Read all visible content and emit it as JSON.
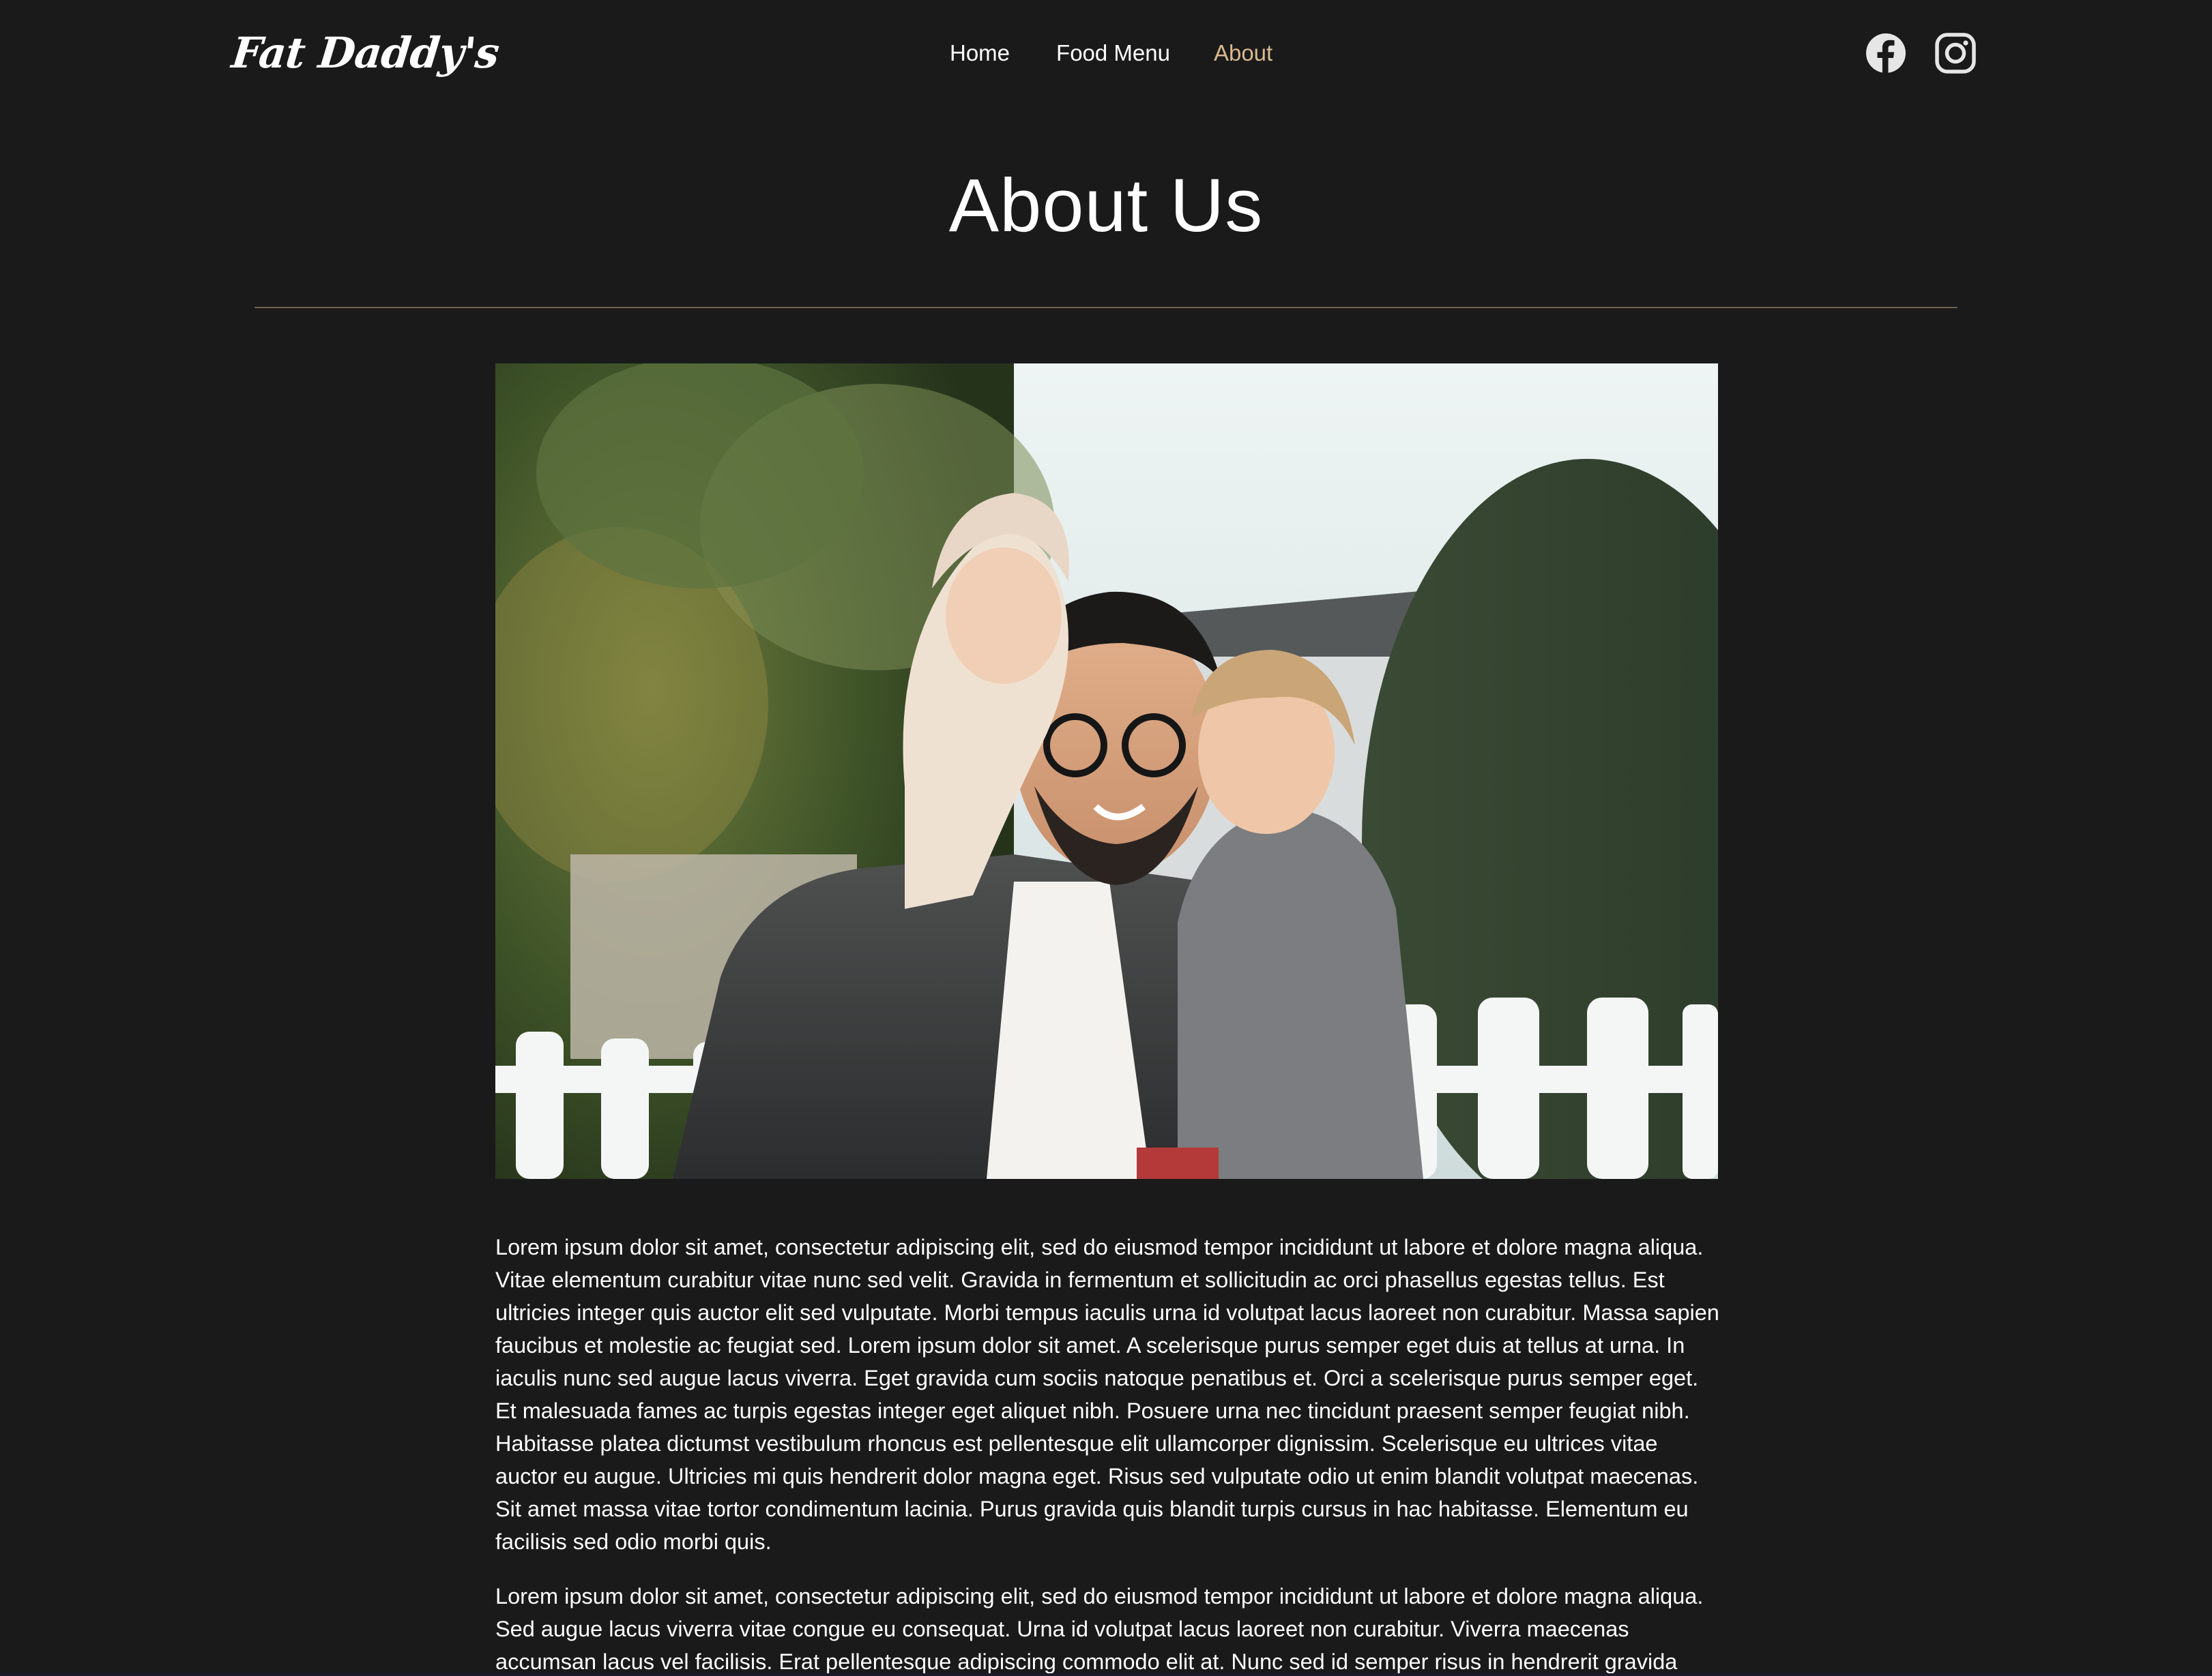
{
  "brand": {
    "logo_text": "Fat Daddy's"
  },
  "nav": {
    "items": [
      {
        "label": "Home",
        "active": false
      },
      {
        "label": "Food Menu",
        "active": false
      },
      {
        "label": "About",
        "active": true
      }
    ]
  },
  "social": {
    "icons": [
      "facebook-icon",
      "instagram-icon"
    ]
  },
  "page": {
    "title": "About Us"
  },
  "colors": {
    "background": "#1a1a1b",
    "text": "#ffffff",
    "accent": "#d9b98e",
    "divider": "#6f6050"
  },
  "content": {
    "paragraphs": [
      "Lorem ipsum dolor sit amet, consectetur adipiscing elit, sed do eiusmod tempor incididunt ut labore et dolore magna aliqua. Vitae elementum curabitur vitae nunc sed velit. Gravida in fermentum et sollicitudin ac orci phasellus egestas tellus. Est ultricies integer quis auctor elit sed vulputate. Morbi tempus iaculis urna id volutpat lacus laoreet non curabitur. Massa sapien faucibus et molestie ac feugiat sed. Lorem ipsum dolor sit amet. A scelerisque purus semper eget duis at tellus at urna. In iaculis nunc sed augue lacus viverra. Eget gravida cum sociis natoque penatibus et. Orci a scelerisque purus semper eget. Et malesuada fames ac turpis egestas integer eget aliquet nibh. Posuere urna nec tincidunt praesent semper feugiat nibh. Habitasse platea dictumst vestibulum rhoncus est pellentesque elit ullamcorper dignissim. Scelerisque eu ultrices vitae auctor eu augue. Ultricies mi quis hendrerit dolor magna eget. Risus sed vulputate odio ut enim blandit volutpat maecenas. Sit amet massa vitae tortor condimentum lacinia. Purus gravida quis blandit turpis cursus in hac habitasse. Elementum eu facilisis sed odio morbi quis.",
      "Lorem ipsum dolor sit amet, consectetur adipiscing elit, sed do eiusmod tempor incididunt ut labore et dolore magna aliqua. Sed augue lacus viverra vitae congue eu consequat. Urna id volutpat lacus laoreet non curabitur. Viverra maecenas accumsan lacus vel facilisis. Erat pellentesque adipiscing commodo elit at. Nunc sed id semper risus in hendrerit gravida rutrum. Augue"
    ]
  }
}
